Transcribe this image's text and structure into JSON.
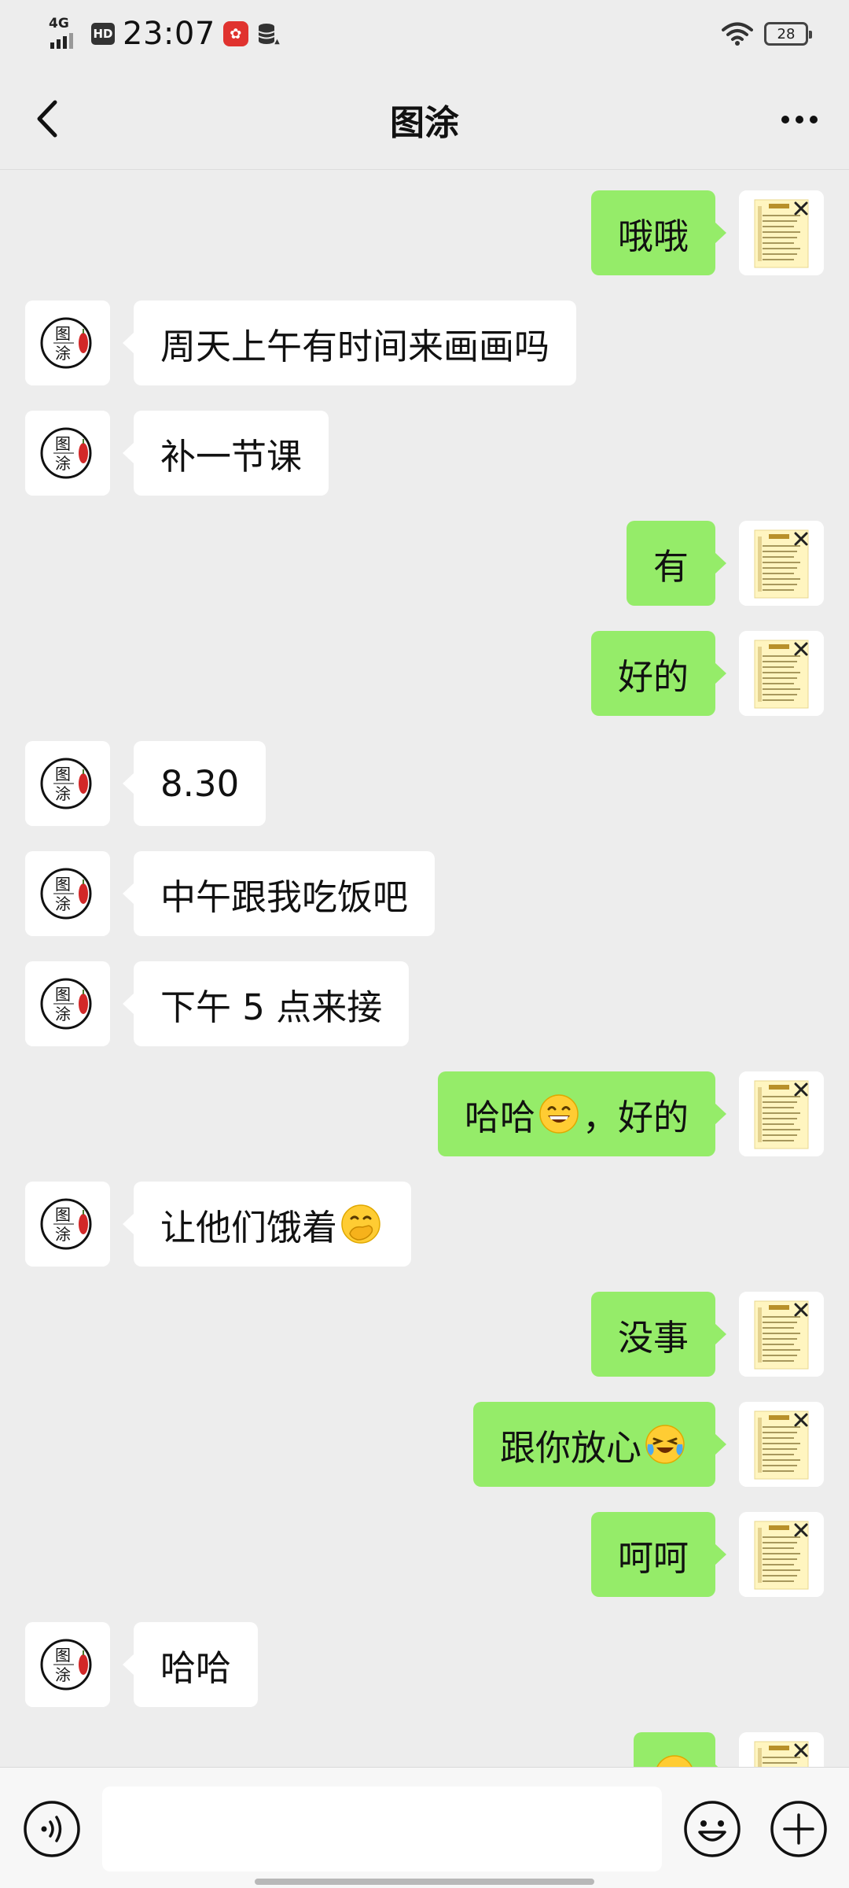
{
  "status_bar": {
    "network": "4G",
    "hd": "HD",
    "time": "23:07",
    "battery": "28"
  },
  "nav": {
    "title": "图涂"
  },
  "contact_avatar_text": [
    "图",
    "涂"
  ],
  "messages": [
    {
      "dir": "out",
      "text": "哦哦"
    },
    {
      "dir": "in",
      "text": "周天上午有时间来画画吗"
    },
    {
      "dir": "in",
      "text": "补一节课"
    },
    {
      "dir": "out",
      "text": "有"
    },
    {
      "dir": "out",
      "text": "好的"
    },
    {
      "dir": "in",
      "text": "8.30"
    },
    {
      "dir": "in",
      "text": "中午跟我吃饭吧"
    },
    {
      "dir": "in",
      "text": "下午 5 点来接"
    },
    {
      "dir": "out",
      "text_before": "哈哈",
      "emoji": "grin-emoji",
      "text_after": "，好的"
    },
    {
      "dir": "in",
      "text_before": "让他们饿着",
      "emoji": "hand-over-mouth-emoji",
      "text_after": ""
    },
    {
      "dir": "out",
      "text": "没事"
    },
    {
      "dir": "out",
      "text_before": "跟你放心",
      "emoji": "crying-laughing-emoji",
      "text_after": ""
    },
    {
      "dir": "out",
      "text": "呵呵"
    },
    {
      "dir": "in",
      "text": "哈哈"
    },
    {
      "dir": "out",
      "text": "",
      "emoji": "partial-emoji"
    }
  ],
  "input": {
    "placeholder": "",
    "value": ""
  },
  "icons": {
    "back": "chevron-left-icon",
    "more": "more-icon",
    "voice": "voice-icon",
    "emoji": "smiley-icon",
    "plus": "plus-icon"
  },
  "colors": {
    "background": "#ededed",
    "outgoing_bubble": "#95ec69",
    "incoming_bubble": "#ffffff"
  }
}
